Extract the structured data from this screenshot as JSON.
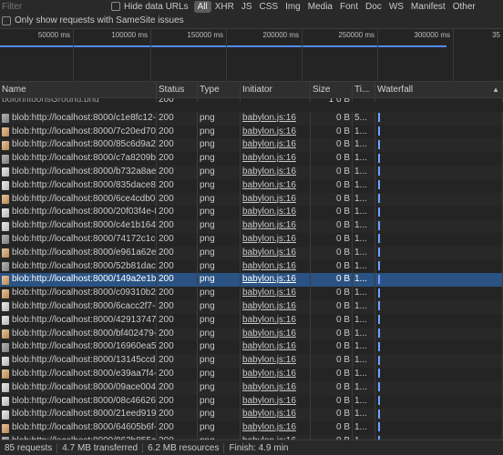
{
  "filter": {
    "placeholder": "Filter"
  },
  "hide_data_urls": "Hide data URLs",
  "type_filters": [
    "All",
    "XHR",
    "JS",
    "CSS",
    "Img",
    "Media",
    "Font",
    "Doc",
    "WS",
    "Manifest",
    "Other"
  ],
  "active_type": "All",
  "samesite_label": "Only show requests with SameSite issues",
  "overview_ticks": [
    "50000 ms",
    "100000 ms",
    "150000 ms",
    "200000 ms",
    "250000 ms",
    "300000 ms",
    "35"
  ],
  "columns": {
    "name": "Name",
    "status": "Status",
    "type": "Type",
    "initiator": "Initiator",
    "size": "Size",
    "time": "Ti...",
    "waterfall": "Waterfall"
  },
  "partial_row": {
    "name": "bolon/jtoonsGround.png",
    "status": "200",
    "size": "1 0 B"
  },
  "rows": [
    {
      "name": "blob:http://localhost:8000/c1e8fc12-d...",
      "status": "200",
      "type": "png",
      "initiator": "babylon.js:16",
      "size": "0 B",
      "time": "5...",
      "icon": "a"
    },
    {
      "name": "blob:http://localhost:8000/7c20ed70-2...",
      "status": "200",
      "type": "png",
      "initiator": "babylon.js:16",
      "size": "0 B",
      "time": "1...",
      "icon": "b"
    },
    {
      "name": "blob:http://localhost:8000/85c6d9a2-4...",
      "status": "200",
      "type": "png",
      "initiator": "babylon.js:16",
      "size": "0 B",
      "time": "1...",
      "icon": "b"
    },
    {
      "name": "blob:http://localhost:8000/c7a8209b-8...",
      "status": "200",
      "type": "png",
      "initiator": "babylon.js:16",
      "size": "0 B",
      "time": "1...",
      "icon": "a"
    },
    {
      "name": "blob:http://localhost:8000/b732a8ae-3...",
      "status": "200",
      "type": "png",
      "initiator": "babylon.js:16",
      "size": "0 B",
      "time": "1...",
      "icon": "c"
    },
    {
      "name": "blob:http://localhost:8000/835dace8-c...",
      "status": "200",
      "type": "png",
      "initiator": "babylon.js:16",
      "size": "0 B",
      "time": "1...",
      "icon": "c"
    },
    {
      "name": "blob:http://localhost:8000/6ce4cdb0-d...",
      "status": "200",
      "type": "png",
      "initiator": "babylon.js:16",
      "size": "0 B",
      "time": "1...",
      "icon": "b"
    },
    {
      "name": "blob:http://localhost:8000/20f03f4e-81...",
      "status": "200",
      "type": "png",
      "initiator": "babylon.js:16",
      "size": "0 B",
      "time": "1...",
      "icon": "c"
    },
    {
      "name": "blob:http://localhost:8000/c4e1b164-d...",
      "status": "200",
      "type": "png",
      "initiator": "babylon.js:16",
      "size": "0 B",
      "time": "1...",
      "icon": "c"
    },
    {
      "name": "blob:http://localhost:8000/74172c1c-a...",
      "status": "200",
      "type": "png",
      "initiator": "babylon.js:16",
      "size": "0 B",
      "time": "1...",
      "icon": "a"
    },
    {
      "name": "blob:http://localhost:8000/e961a62e-4...",
      "status": "200",
      "type": "png",
      "initiator": "babylon.js:16",
      "size": "0 B",
      "time": "1...",
      "icon": "b"
    },
    {
      "name": "blob:http://localhost:8000/52b81dac-c...",
      "status": "200",
      "type": "png",
      "initiator": "babylon.js:16",
      "size": "0 B",
      "time": "1...",
      "icon": "a"
    },
    {
      "name": "blob:http://localhost:8000/149a2e1b-8...",
      "status": "200",
      "type": "png",
      "initiator": "babylon.js:16",
      "size": "0 B",
      "time": "1...",
      "icon": "b",
      "selected": true
    },
    {
      "name": "blob:http://localhost:8000/c09310b2-7...",
      "status": "200",
      "type": "png",
      "initiator": "babylon.js:16",
      "size": "0 B",
      "time": "1...",
      "icon": "b"
    },
    {
      "name": "blob:http://localhost:8000/6cacc2f7-6...",
      "status": "200",
      "type": "png",
      "initiator": "babylon.js:16",
      "size": "0 B",
      "time": "1...",
      "icon": "c"
    },
    {
      "name": "blob:http://localhost:8000/42913747-6...",
      "status": "200",
      "type": "png",
      "initiator": "babylon.js:16",
      "size": "0 B",
      "time": "1...",
      "icon": "c"
    },
    {
      "name": "blob:http://localhost:8000/bf402479-6...",
      "status": "200",
      "type": "png",
      "initiator": "babylon.js:16",
      "size": "0 B",
      "time": "1...",
      "icon": "b"
    },
    {
      "name": "blob:http://localhost:8000/16960ea5-4...",
      "status": "200",
      "type": "png",
      "initiator": "babylon.js:16",
      "size": "0 B",
      "time": "1...",
      "icon": "a"
    },
    {
      "name": "blob:http://localhost:8000/13145ccd-7...",
      "status": "200",
      "type": "png",
      "initiator": "babylon.js:16",
      "size": "0 B",
      "time": "1...",
      "icon": "c"
    },
    {
      "name": "blob:http://localhost:8000/e39aa7f4-4...",
      "status": "200",
      "type": "png",
      "initiator": "babylon.js:16",
      "size": "0 B",
      "time": "1...",
      "icon": "b"
    },
    {
      "name": "blob:http://localhost:8000/09ace004-7...",
      "status": "200",
      "type": "png",
      "initiator": "babylon.js:16",
      "size": "0 B",
      "time": "1...",
      "icon": "c"
    },
    {
      "name": "blob:http://localhost:8000/08c46626-5...",
      "status": "200",
      "type": "png",
      "initiator": "babylon.js:16",
      "size": "0 B",
      "time": "1...",
      "icon": "c"
    },
    {
      "name": "blob:http://localhost:8000/21eed919-8...",
      "status": "200",
      "type": "png",
      "initiator": "babylon.js:16",
      "size": "0 B",
      "time": "1...",
      "icon": "c"
    },
    {
      "name": "blob:http://localhost:8000/64605b6f-d...",
      "status": "200",
      "type": "png",
      "initiator": "babylon.js:16",
      "size": "0 B",
      "time": "1...",
      "icon": "b"
    },
    {
      "name": "blob:http://localhost:8000/863b855a-5...",
      "status": "200",
      "type": "png",
      "initiator": "babylon.js:16",
      "size": "0 B",
      "time": "1...",
      "icon": "a"
    }
  ],
  "status_bar": {
    "requests": "85 requests",
    "transferred": "4.7 MB transferred",
    "resources": "6.2 MB resources",
    "finish": "Finish: 4.9 min"
  }
}
